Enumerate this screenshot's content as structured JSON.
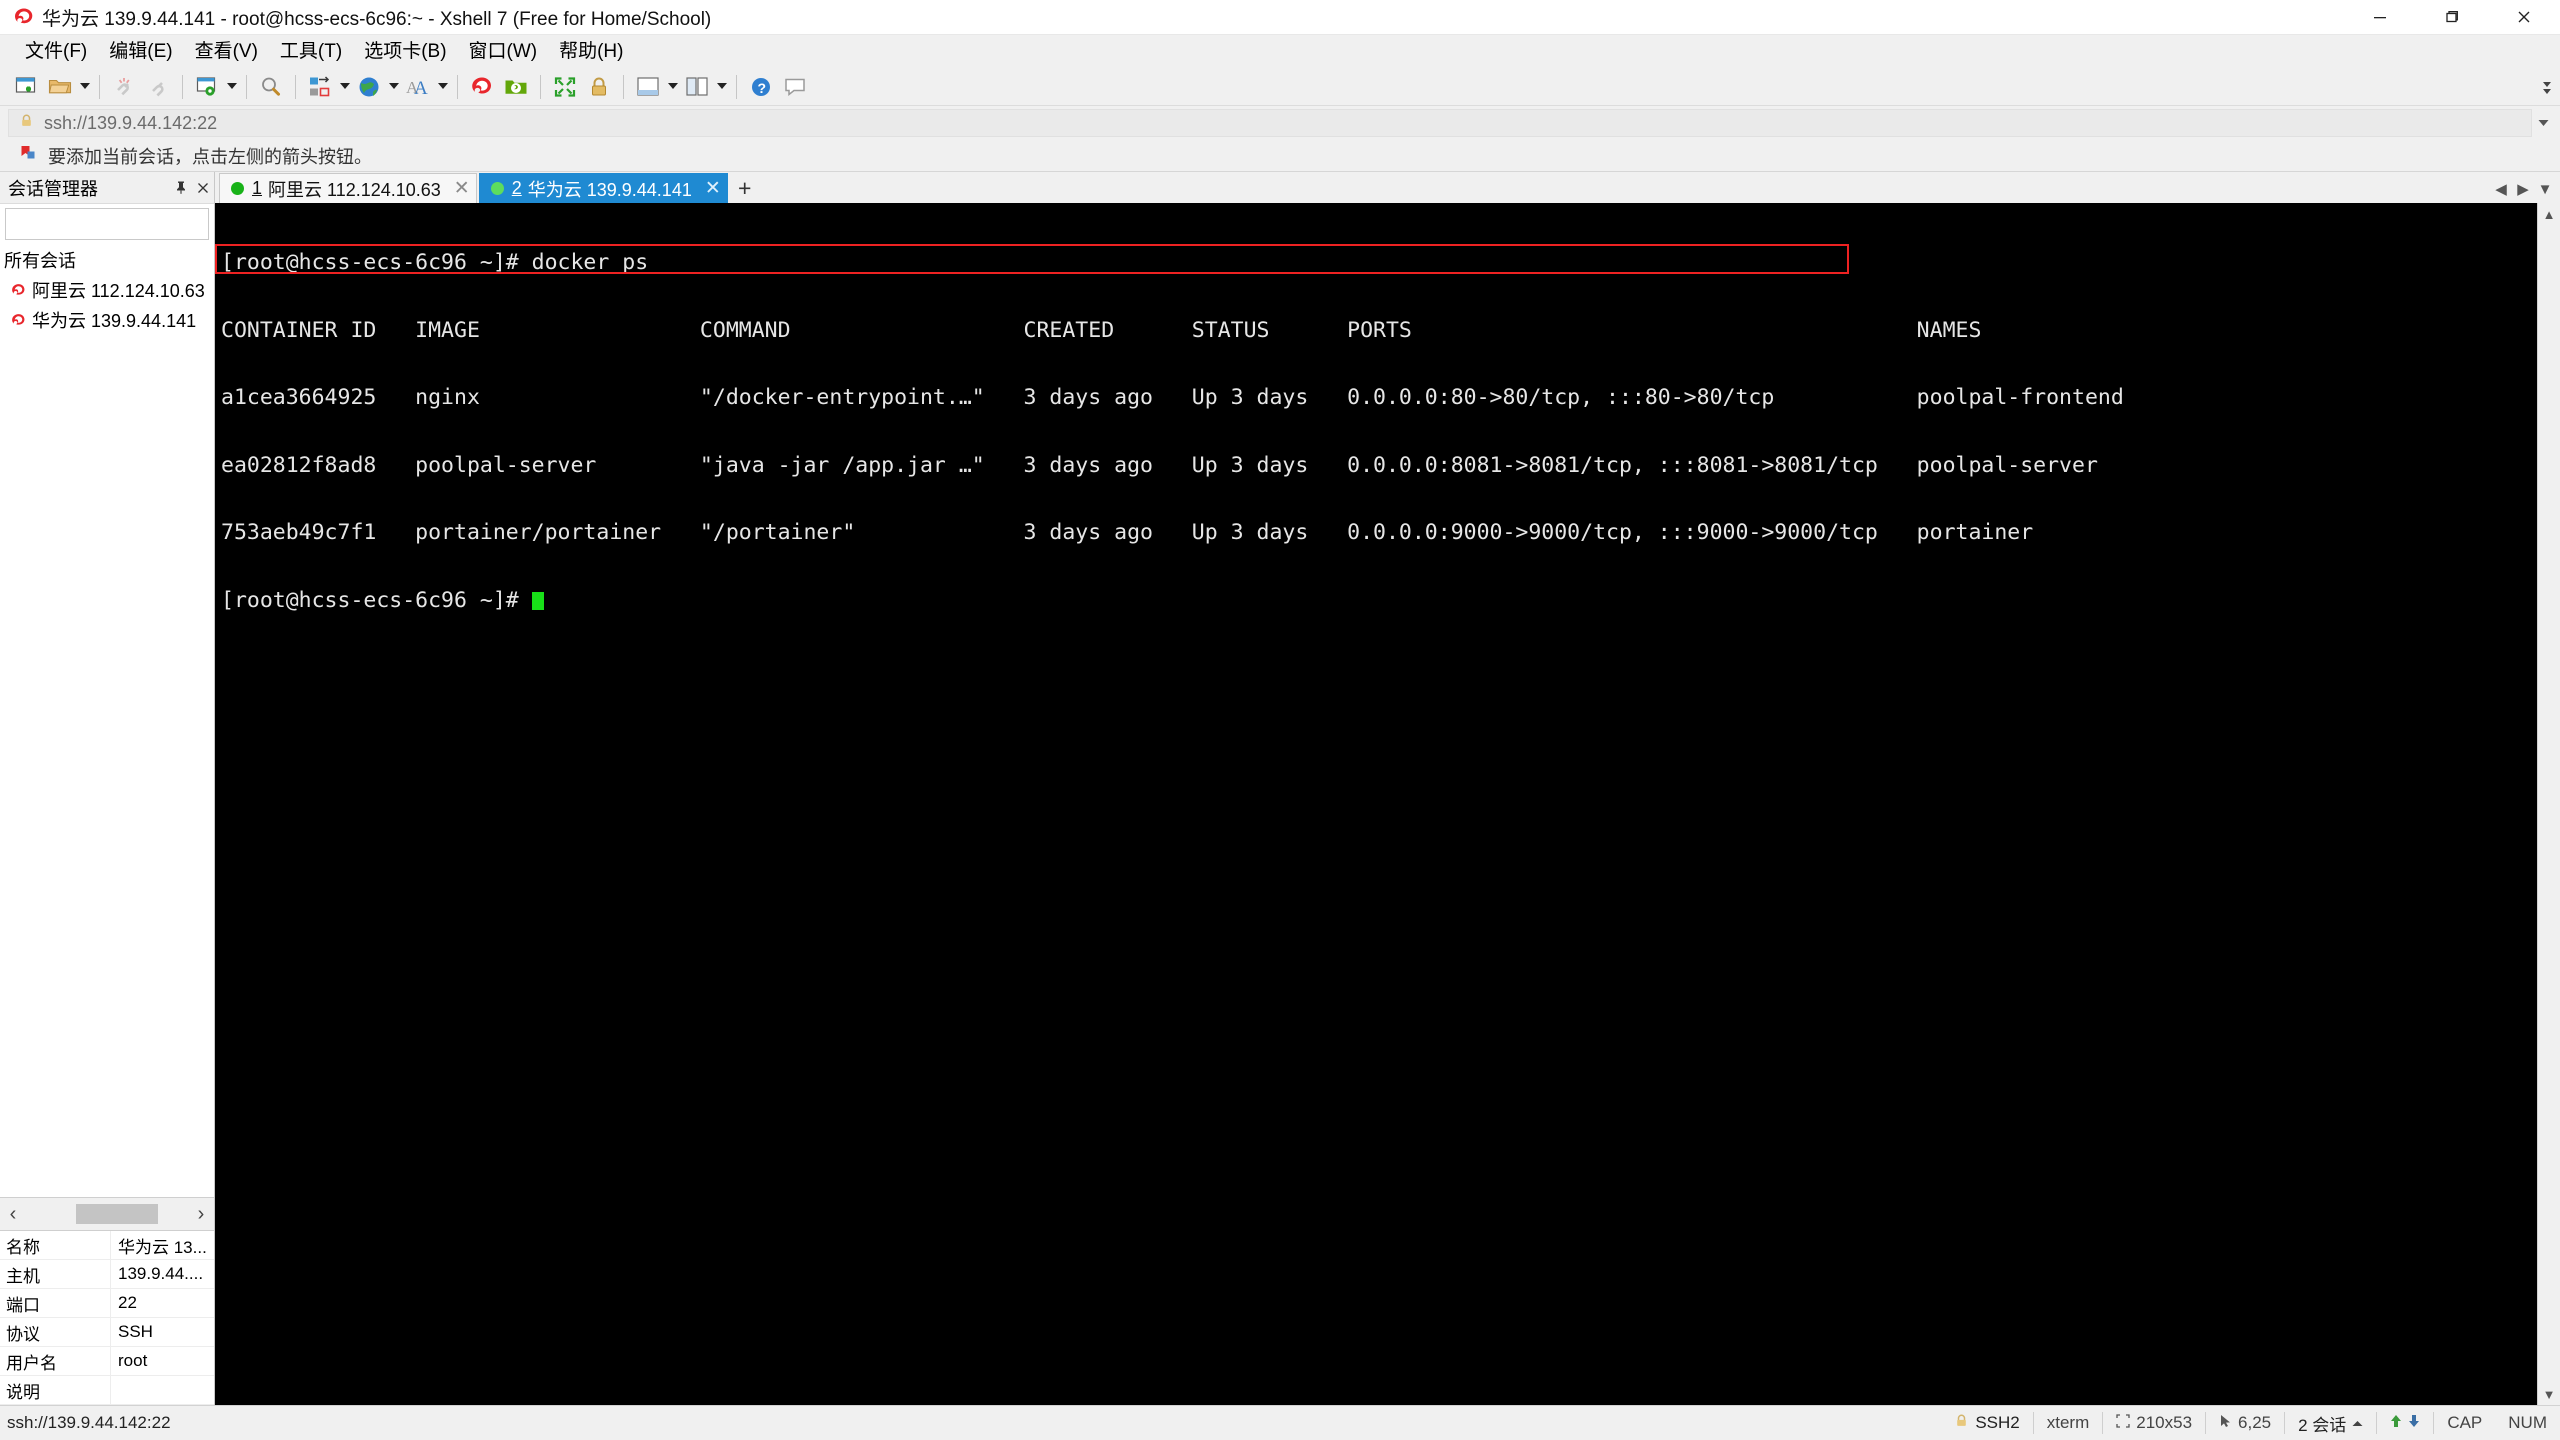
{
  "window": {
    "title": "华为云 139.9.44.141 - root@hcss-ecs-6c96:~ - Xshell 7 (Free for Home/School)",
    "logo_icon": "xshell-logo-icon",
    "minimize_label": "最小化",
    "maximize_label": "最大化",
    "close_label": "关闭"
  },
  "menu": {
    "items": [
      {
        "label": "文件(F)",
        "name": "menu-file"
      },
      {
        "label": "编辑(E)",
        "name": "menu-edit"
      },
      {
        "label": "查看(V)",
        "name": "menu-view"
      },
      {
        "label": "工具(T)",
        "name": "menu-tools"
      },
      {
        "label": "选项卡(B)",
        "name": "menu-tab"
      },
      {
        "label": "窗口(W)",
        "name": "menu-window"
      },
      {
        "label": "帮助(H)",
        "name": "menu-help"
      }
    ]
  },
  "toolbar": {
    "items": [
      {
        "icon": "new-session-icon",
        "tooltip": "新建会话"
      },
      {
        "icon": "open-folder-icon",
        "tooltip": "打开会话",
        "caret": true
      },
      {
        "icon": "disconnect-icon",
        "tooltip": "断开连接"
      },
      {
        "icon": "reconnect-icon",
        "tooltip": "重新连接"
      },
      {
        "icon": "session-properties-icon",
        "tooltip": "属性",
        "caret": true
      },
      {
        "icon": "find-icon",
        "tooltip": "查找"
      },
      {
        "icon": "file-transfer-icon",
        "tooltip": "文件传输",
        "caret": true
      },
      {
        "icon": "globe-icon",
        "tooltip": "编码",
        "caret": true
      },
      {
        "icon": "font-icon",
        "tooltip": "字体",
        "caret": true
      },
      {
        "icon": "xshell-icon",
        "tooltip": "Xshell"
      },
      {
        "icon": "xftp-icon",
        "tooltip": "新建文件传输"
      },
      {
        "icon": "fullscreen-icon",
        "tooltip": "全屏"
      },
      {
        "icon": "lock-icon",
        "tooltip": "锁定"
      },
      {
        "icon": "compose-pane-icon",
        "tooltip": "撰写窗格",
        "caret": true
      },
      {
        "icon": "layout-icon",
        "tooltip": "排列",
        "caret": true
      },
      {
        "icon": "help-icon",
        "tooltip": "帮助"
      },
      {
        "icon": "feedback-icon",
        "tooltip": "反馈"
      }
    ],
    "overflow_icon": "toolbar-overflow-icon"
  },
  "address_bar": {
    "lock_icon": "lock-icon",
    "value": "ssh://139.9.44.142:22",
    "placeholder": "ssh://",
    "dropdown_icon": "chevron-down-icon"
  },
  "notice": {
    "icon": "bookmark-icon",
    "text": "要添加当前会话，点击左侧的箭头按钮。"
  },
  "sidebar": {
    "title": "会话管理器",
    "pin_icon": "pin-icon",
    "close_icon": "close-icon",
    "search": {
      "value": "",
      "placeholder": "",
      "icon": "search-icon"
    },
    "tree_root": "所有会话",
    "sessions": [
      {
        "label": "阿里云 112.124.10.63",
        "icon": "xshell-session-icon"
      },
      {
        "label": "华为云 139.9.44.141",
        "icon": "xshell-session-icon"
      }
    ],
    "pager": {
      "prev_icon": "chevron-left-icon",
      "next_icon": "chevron-right-icon"
    },
    "properties": [
      {
        "key": "名称",
        "value": "华为云 13..."
      },
      {
        "key": "主机",
        "value": "139.9.44...."
      },
      {
        "key": "端口",
        "value": "22"
      },
      {
        "key": "协议",
        "value": "SSH"
      },
      {
        "key": "用户名",
        "value": "root"
      },
      {
        "key": "说明",
        "value": ""
      }
    ]
  },
  "tabs": {
    "items": [
      {
        "num": "1",
        "label": "阿里云 112.124.10.63",
        "active": false,
        "close_icon": "close-icon",
        "status": "connected"
      },
      {
        "num": "2",
        "label": "华为云 139.9.44.141",
        "active": true,
        "close_icon": "close-icon",
        "status": "connected"
      }
    ],
    "add_label": "+",
    "nav_prev_icon": "chevron-left-icon",
    "nav_next_icon": "chevron-down-icon"
  },
  "terminal": {
    "lines": [
      "[root@hcss-ecs-6c96 ~]# docker ps",
      "CONTAINER ID   IMAGE                 COMMAND                  CREATED      STATUS      PORTS                                       NAMES",
      "a1cea3664925   nginx                 \"/docker-entrypoint.…\"   3 days ago   Up 3 days   0.0.0.0:80->80/tcp, :::80->80/tcp           poolpal-frontend",
      "ea02812f8ad8   poolpal-server        \"java -jar /app.jar …\"   3 days ago   Up 3 days   0.0.0.0:8081->8081/tcp, :::8081->8081/tcp   poolpal-server",
      "753aeb49c7f1   portainer/portainer   \"/portainer\"             3 days ago   Up 3 days   0.0.0.0:9000->9000/tcp, :::9000->9000/tcp   portainer"
    ],
    "prompt": "[root@hcss-ecs-6c96 ~]# ",
    "highlight_color": "#ee2222",
    "fg_color": "#e6e6e6",
    "bg_color": "#000000",
    "cursor_color": "#18e018"
  },
  "statusbar": {
    "left": "ssh://139.9.44.142:22",
    "ssh_icon": "lock-icon",
    "protocol": "SSH2",
    "term_type": "xterm",
    "size_icon": "size-icon",
    "size": "210x53",
    "cursor_icon": "cursor-icon",
    "cursor_pos": "6,25",
    "sessions": "2 会话",
    "sessions_caret_icon": "chevron-up-icon",
    "upload_icon": "arrow-up-icon",
    "download_icon": "arrow-down-icon",
    "caps": "CAP",
    "num": "NUM"
  }
}
